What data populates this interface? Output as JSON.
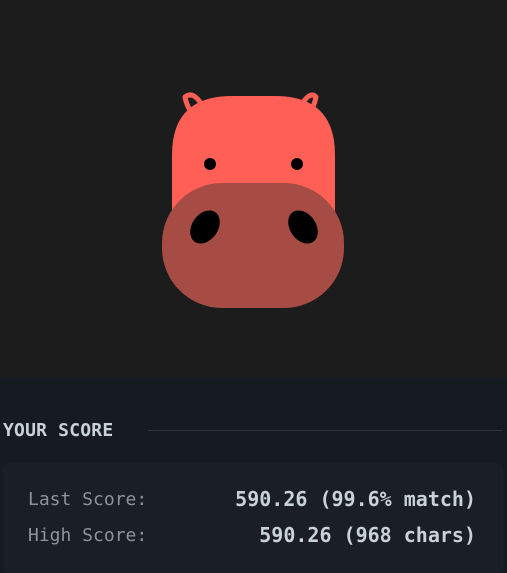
{
  "preview": {
    "image": "hippo-face-illustration",
    "colors": {
      "background": "#1c1c1c",
      "head": "#ff5f55",
      "snout": "#a64c44",
      "eyes": "#000000"
    }
  },
  "score": {
    "title": "YOUR SCORE",
    "last_label": "Last Score:",
    "last_value": "590.26 (99.6% match)",
    "high_label": "High Score:",
    "high_value": "590.26 (968 chars)"
  }
}
